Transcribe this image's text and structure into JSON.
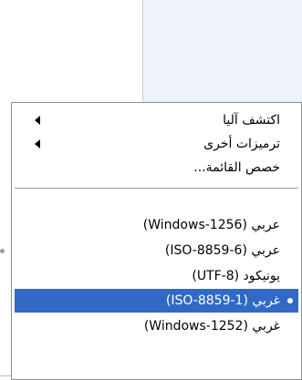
{
  "menu": {
    "items": [
      {
        "label": "اكتشف آليا",
        "submenu": true
      },
      {
        "label": "ترميزات أخرى",
        "submenu": true
      },
      {
        "label": "خصص القائمة...",
        "submenu": false
      }
    ],
    "encodings": [
      {
        "label": "عربي (Windows-1256)",
        "selected": false
      },
      {
        "label": "عربي (ISO-8859-6)",
        "selected": false
      },
      {
        "label": "يونيكود (UTF-8)",
        "selected": false
      },
      {
        "label": "غربي (ISO-8859-1)",
        "selected": true
      },
      {
        "label": "غربي (Windows-1252)",
        "selected": false
      }
    ]
  },
  "colors": {
    "highlight": "#316ac5",
    "highlight_text": "#ffffff",
    "border": "#8e8f8f"
  }
}
